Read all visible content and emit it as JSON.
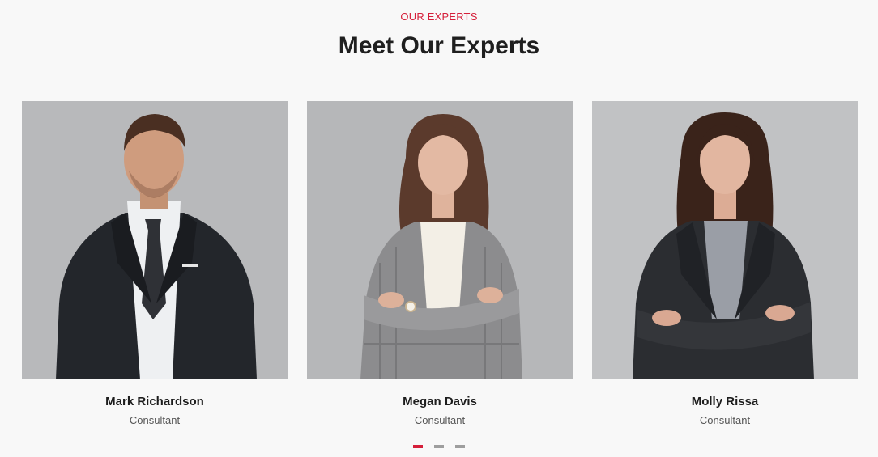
{
  "section": {
    "eyebrow": "OUR EXPERTS",
    "title": "Meet Our Experts"
  },
  "experts": [
    {
      "name": "Mark Richardson",
      "role": "Consultant"
    },
    {
      "name": "Megan Davis",
      "role": "Consultant"
    },
    {
      "name": "Molly Rissa",
      "role": "Consultant"
    }
  ],
  "carousel": {
    "pages": 3,
    "active_index": 0
  },
  "colors": {
    "accent": "#d51f3a",
    "background": "#f8f8f8",
    "photo_background": "#b9babc",
    "dot_inactive": "#9e9e9e"
  }
}
